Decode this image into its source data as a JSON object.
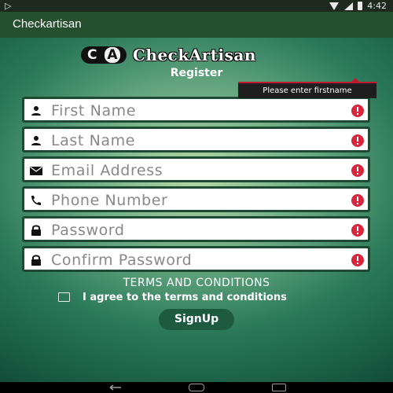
{
  "status_bar": {
    "time": "4:42"
  },
  "app_bar": {
    "title": "Checkartisan"
  },
  "logo": {
    "badge_c": "C",
    "badge_a": "A",
    "text": "CheckArtisan"
  },
  "form": {
    "heading": "Register",
    "fields": [
      {
        "icon": "person-icon",
        "placeholder": "First Name",
        "value": "",
        "error": true
      },
      {
        "icon": "person-icon",
        "placeholder": "Last Name",
        "value": "",
        "error": true
      },
      {
        "icon": "email-icon",
        "placeholder": "Email Address",
        "value": "",
        "error": true
      },
      {
        "icon": "phone-icon",
        "placeholder": "Phone Number",
        "value": "",
        "error": true
      },
      {
        "icon": "lock-icon",
        "placeholder": "Password",
        "value": "",
        "error": true
      },
      {
        "icon": "lock-icon",
        "placeholder": "Confirm Password",
        "value": "",
        "error": true
      }
    ],
    "tooltip": "Please enter firstname",
    "terms_title": "TERMS AND CONDITIONS",
    "terms_label": "I agree to the terms and conditions",
    "terms_checked": false,
    "signup_label": "SignUp"
  },
  "colors": {
    "app_bar": "#254f2f",
    "field_border": "#1e4a34",
    "error": "#d7263d",
    "button": "#1e5a3f"
  }
}
